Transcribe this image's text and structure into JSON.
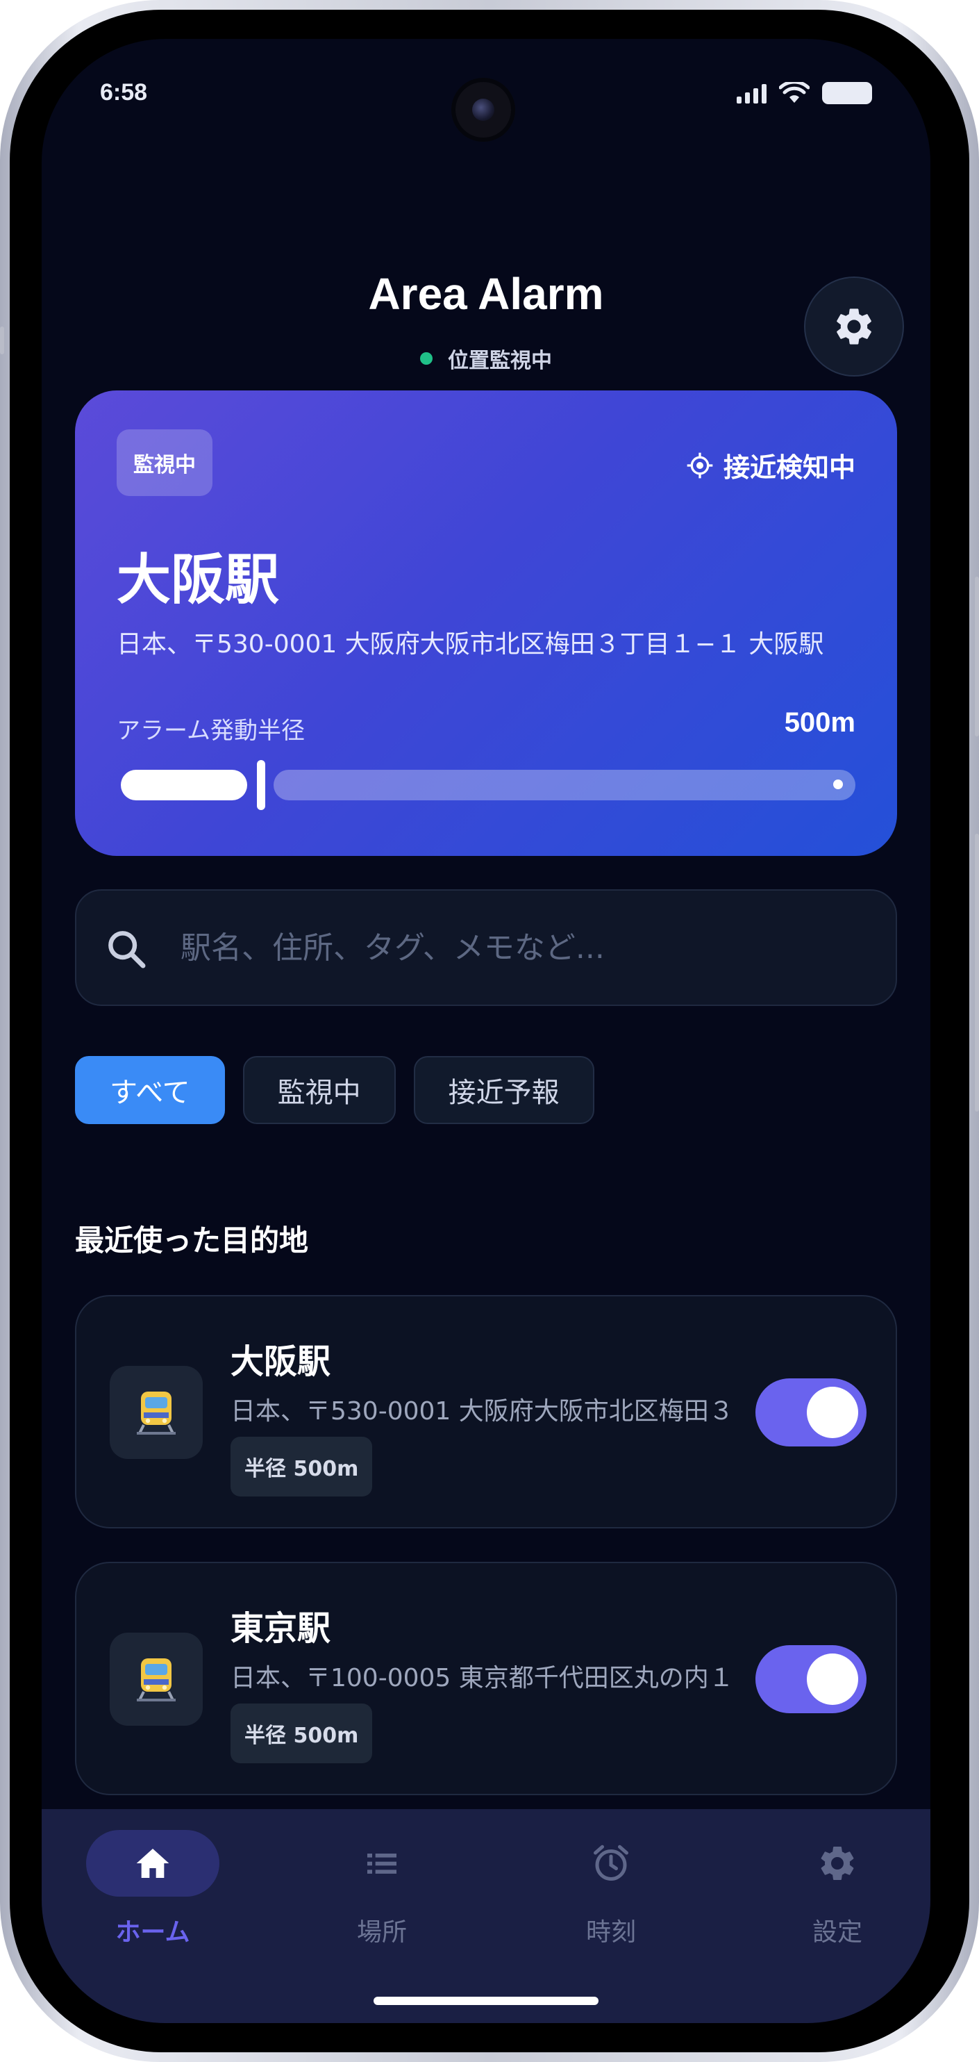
{
  "status_bar": {
    "time": "6:58"
  },
  "header": {
    "title": "Area Alarm",
    "status_text": "位置監視中"
  },
  "hero": {
    "badge": "監視中",
    "detect_label": "接近検知中",
    "station_name": "大阪駅",
    "address": "日本、〒530-0001 大阪府大阪市北区梅田３丁目１−１ 大阪駅",
    "radius_label": "アラーム発動半径",
    "radius_value": "500m",
    "radius_slider_fraction": 0.19
  },
  "search": {
    "placeholder": "駅名、住所、タグ、メモなど..."
  },
  "filters": [
    {
      "label": "すべて",
      "active": true
    },
    {
      "label": "監視中",
      "active": false
    },
    {
      "label": "接近予報",
      "active": false
    }
  ],
  "recent": {
    "title": "最近使った目的地",
    "items": [
      {
        "name": "大阪駅",
        "address": "日本、〒530-0001 大阪府大阪市北区梅田３",
        "radius_badge": "半径 500m",
        "icon": "train-icon",
        "enabled": true
      },
      {
        "name": "東京駅",
        "address": "日本、〒100-0005 東京都千代田区丸の内１",
        "radius_badge": "半径 500m",
        "icon": "train-icon",
        "enabled": true
      }
    ]
  },
  "nav": {
    "items": [
      {
        "label": "ホーム",
        "icon": "home-icon",
        "active": true
      },
      {
        "label": "場所",
        "icon": "list-icon",
        "active": false
      },
      {
        "label": "時刻",
        "icon": "alarm-clock-icon",
        "active": false
      },
      {
        "label": "設定",
        "icon": "gear-icon",
        "active": false
      }
    ]
  },
  "colors": {
    "background": "#05081a",
    "accent": "#6a63ee",
    "chip_active": "#3a8bf6",
    "status_dot": "#20c088",
    "hero_gradient_start": "#5b4bd9",
    "hero_gradient_end": "#2450d8"
  }
}
